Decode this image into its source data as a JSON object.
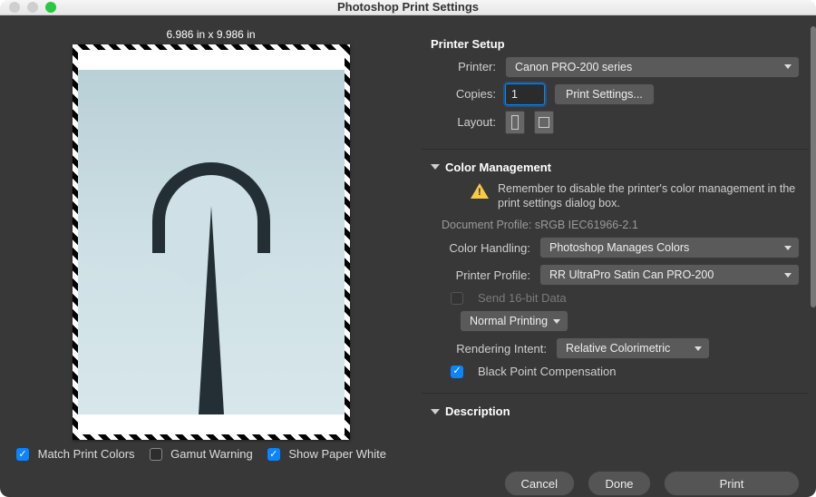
{
  "window": {
    "title": "Photoshop Print Settings"
  },
  "preview": {
    "dimensions": "6.986 in x 9.986 in",
    "match_colors": "Match Print Colors",
    "gamut_warning": "Gamut Warning",
    "show_paper_white": "Show Paper White"
  },
  "printer_setup": {
    "title": "Printer Setup",
    "labels": {
      "printer": "Printer:",
      "copies": "Copies:",
      "layout": "Layout:"
    },
    "printer_value": "Canon PRO-200 series",
    "copies_value": "1",
    "print_settings_btn": "Print Settings..."
  },
  "color_mgmt": {
    "title": "Color Management",
    "warning": "Remember to disable the printer's color management in the print settings dialog box.",
    "doc_profile_label": "Document Profile:",
    "doc_profile_value": "sRGB IEC61966-2.1",
    "labels": {
      "color_handling": "Color Handling:",
      "printer_profile": "Printer Profile:",
      "send16": "Send 16-bit Data",
      "mode": "Normal Printing",
      "rendering_intent": "Rendering Intent:",
      "bpc": "Black Point Compensation"
    },
    "color_handling_value": "Photoshop Manages Colors",
    "printer_profile_value": "RR UltraPro Satin Can PRO-200",
    "rendering_intent_value": "Relative Colorimetric"
  },
  "description": {
    "title": "Description"
  },
  "footer": {
    "cancel": "Cancel",
    "done": "Done",
    "print": "Print"
  }
}
